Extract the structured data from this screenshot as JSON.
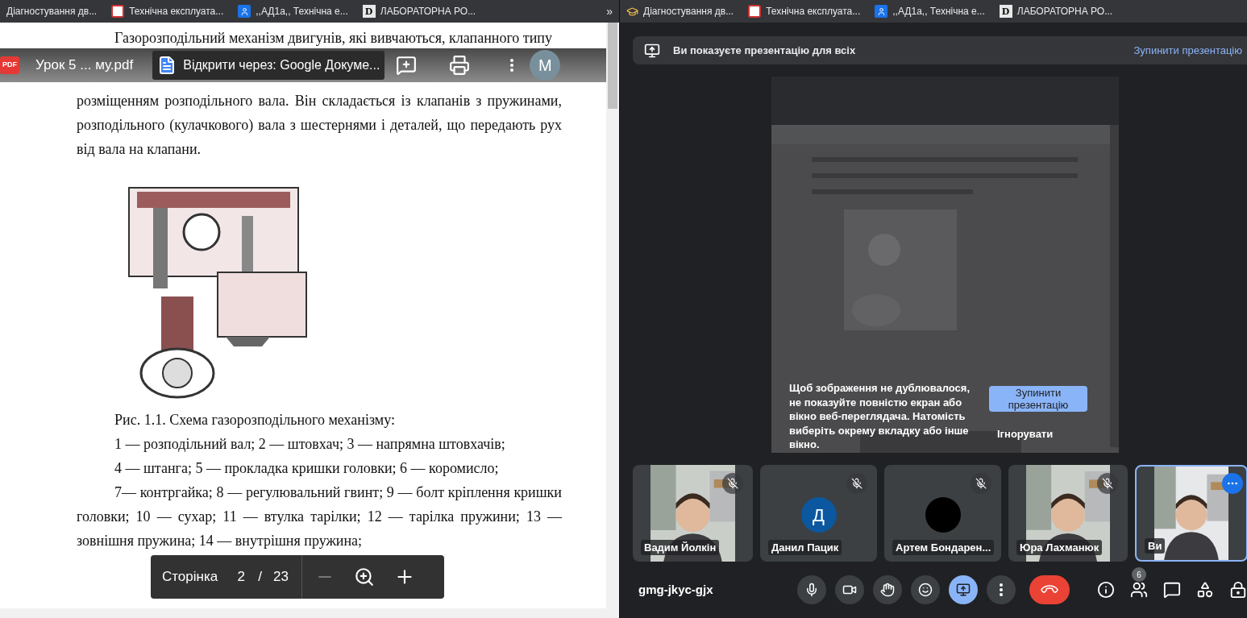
{
  "left_bookmarks": {
    "items": [
      {
        "kind": "plain",
        "label": "Діагностування дв..."
      },
      {
        "kind": "logo",
        "label": "Технічна експлуата..."
      },
      {
        "kind": "contact",
        "label": ",,АД1а,, Технічна е..."
      },
      {
        "kind": "letter",
        "letter": "D",
        "label": "ЛАБОРАТОРНА РО..."
      }
    ],
    "overflow": "»"
  },
  "pdf_viewer": {
    "file_badge": "PDF",
    "file_name": "Урок 5 ... му.pdf",
    "open_with": "Відкрити через: Google Докуме...",
    "avatar": "M",
    "intro_line": "Газорозподільний механізм двигунів, які вивчаються, клапанного типу",
    "paragraph": "розміщенням розподільного вала. Він складається із клапанів з пружинами, розподільного (кулачкового) вала з шестернями і деталей, що передають рух від вала на клапани.",
    "figure": {
      "kind": "picture"
    },
    "caption": [
      "Рис. 1.1. Схема газорозподільного механізму:",
      "1 — розподільний вал; 2 — штовхач; 3 — напрямна штовхачів;",
      "4 — штанга; 5 — прокладка кришки головки; 6 — коромисло;",
      "7— контргайка; 8 — регулювальний гвинт; 9 — болт кріплення кришки головки; 10 — сухар; 11 — втулка тарілки; 12 — тарілка пружини; 13 — зовнішня пружина; 14 — внутрішня пружина;"
    ],
    "page_label": "Сторінка",
    "page": "2",
    "page_separator": "/",
    "page_count": "23"
  },
  "right_bookmarks": {
    "items": [
      {
        "kind": "cap",
        "label": "Діагностування дв..."
      },
      {
        "kind": "logo",
        "label": "Технічна експлуата..."
      },
      {
        "kind": "contact",
        "label": ",,АД1а,, Технічна е..."
      },
      {
        "kind": "letter",
        "letter": "D",
        "label": "ЛАБОРАТОРНА РО..."
      }
    ]
  },
  "meet": {
    "banner_text": "Ви показуєте презентацію для всіх",
    "banner_action": "Зупинити презентацію",
    "preview": {
      "kind": "picture"
    },
    "notice": {
      "text": "Щоб зображення не дублювалося, не показуйте повністю екран або вікно веб-переглядача. Натомість виберіть окрему вкладку або інше вікно.",
      "stop_button": "Зупинити презентацію",
      "ignore_button": "Ігнорувати"
    },
    "participants": [
      {
        "kind": "video",
        "name": "Вадим Йолкін",
        "muted": true,
        "selected": false
      },
      {
        "kind": "initial",
        "initial": "Д",
        "name": "Данил Пацик",
        "muted": true,
        "selected": false
      },
      {
        "kind": "blank",
        "name": "Артем Бондарен...",
        "muted": true,
        "selected": false
      },
      {
        "kind": "video",
        "name": "Юра Лахманюк",
        "muted": true,
        "selected": false
      },
      {
        "kind": "video",
        "name": "Ви",
        "muted": false,
        "selected": true
      }
    ],
    "meeting_code": "gmg-jkyc-gjx",
    "controls": [
      {
        "kind": "mic",
        "selected": false
      },
      {
        "kind": "camera",
        "selected": false
      },
      {
        "kind": "hand",
        "selected": false
      },
      {
        "kind": "emoji",
        "selected": false
      },
      {
        "kind": "present",
        "selected": true
      },
      {
        "kind": "more",
        "selected": false
      },
      {
        "kind": "hangup"
      }
    ],
    "side_controls": [
      {
        "kind": "info"
      },
      {
        "kind": "people",
        "badge": "6"
      },
      {
        "kind": "chat"
      },
      {
        "kind": "activities"
      },
      {
        "kind": "lock"
      }
    ]
  }
}
